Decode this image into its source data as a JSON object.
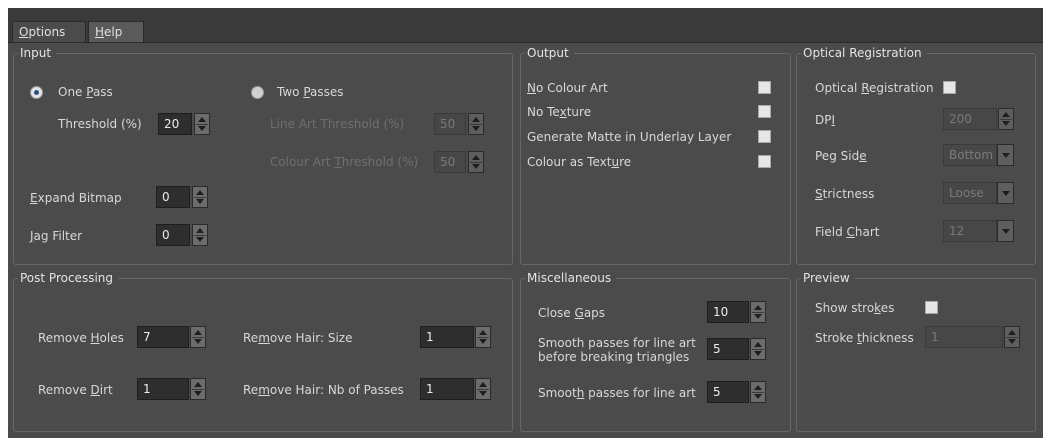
{
  "tabs": {
    "options_pre": "",
    "options_key": "O",
    "options_post": "ptions",
    "help_key": "H",
    "help_post": "elp"
  },
  "input": {
    "title": "Input",
    "one_pass": {
      "pre": "One ",
      "key": "P",
      "post": "ass",
      "checked": true
    },
    "two_passes": {
      "pre": "Two ",
      "key": "P",
      "post": "asses",
      "checked": false
    },
    "threshold_label": "Threshold (%)",
    "threshold_value": "20",
    "line_art_threshold": {
      "pre": "Line Art Threshold (%)"
    },
    "line_art_threshold_value": "50",
    "colour_art_threshold": {
      "pre": "Colour Art ",
      "key": "T",
      "post": "hreshold (%)"
    },
    "colour_art_threshold_value": "50",
    "expand_bitmap": {
      "pre": "",
      "key": "E",
      "post": "xpand Bitmap"
    },
    "expand_bitmap_value": "0",
    "jag_filter": {
      "pre": "",
      "key": "J",
      "post": "ag Filter"
    },
    "jag_filter_value": "0"
  },
  "output": {
    "title": "Output",
    "no_colour_art": {
      "pre": "",
      "key": "N",
      "post": "o Colour Art"
    },
    "no_texture": {
      "pre": "No Te",
      "key": "x",
      "post": "ture"
    },
    "generate_matte": {
      "pre": "Generate Matte in Underlay Layer"
    },
    "colour_as_texture": {
      "pre": "Colour as Text",
      "key": "u",
      "post": "re"
    }
  },
  "optical": {
    "title": "Optical Registration",
    "optical_registration": {
      "pre": "Optical ",
      "key": "R",
      "post": "egistration"
    },
    "dpi": {
      "pre": "DP",
      "key": "I",
      "post": ""
    },
    "dpi_value": "200",
    "peg_side": {
      "pre": "Peg Sid",
      "key": "e",
      "post": ""
    },
    "peg_side_value": "Bottom",
    "strictness": {
      "pre": "",
      "key": "S",
      "post": "trictness"
    },
    "strictness_value": "Loose",
    "field_chart": {
      "pre": "Field ",
      "key": "C",
      "post": "hart"
    },
    "field_chart_value": "12"
  },
  "post_processing": {
    "title": "Post Processing",
    "remove_holes": {
      "pre": "Remove ",
      "key": "H",
      "post": "oles"
    },
    "remove_holes_value": "7",
    "remove_dirt": {
      "pre": "Remove ",
      "key": "D",
      "post": "irt"
    },
    "remove_dirt_value": "1",
    "remove_hair_size": {
      "pre": "Re",
      "key": "m",
      "post": "ove Hair: Size"
    },
    "remove_hair_size_value": "1",
    "remove_hair_passes": {
      "pre": "Re",
      "key": "m",
      "post": "ove Hair: Nb of Passes"
    },
    "remove_hair_passes_value": "1"
  },
  "misc": {
    "title": "Miscellaneous",
    "close_gaps": {
      "pre": "Close ",
      "key": "G",
      "post": "aps"
    },
    "close_gaps_value": "10",
    "smooth_before_1": "Smooth passes for line art",
    "smooth_before_2": "before breaking triangles",
    "smooth_before_value": "5",
    "smooth_line_art": {
      "pre": "Smoot",
      "key": "h",
      "post": " passes for line art"
    },
    "smooth_line_art_value": "5"
  },
  "preview": {
    "title": "Preview",
    "show_strokes": {
      "pre": "Show stro",
      "key": "k",
      "post": "es"
    },
    "stroke_thickness": {
      "pre": "Stroke ",
      "key": "t",
      "post": "hickness"
    },
    "stroke_thickness_value": "1"
  }
}
